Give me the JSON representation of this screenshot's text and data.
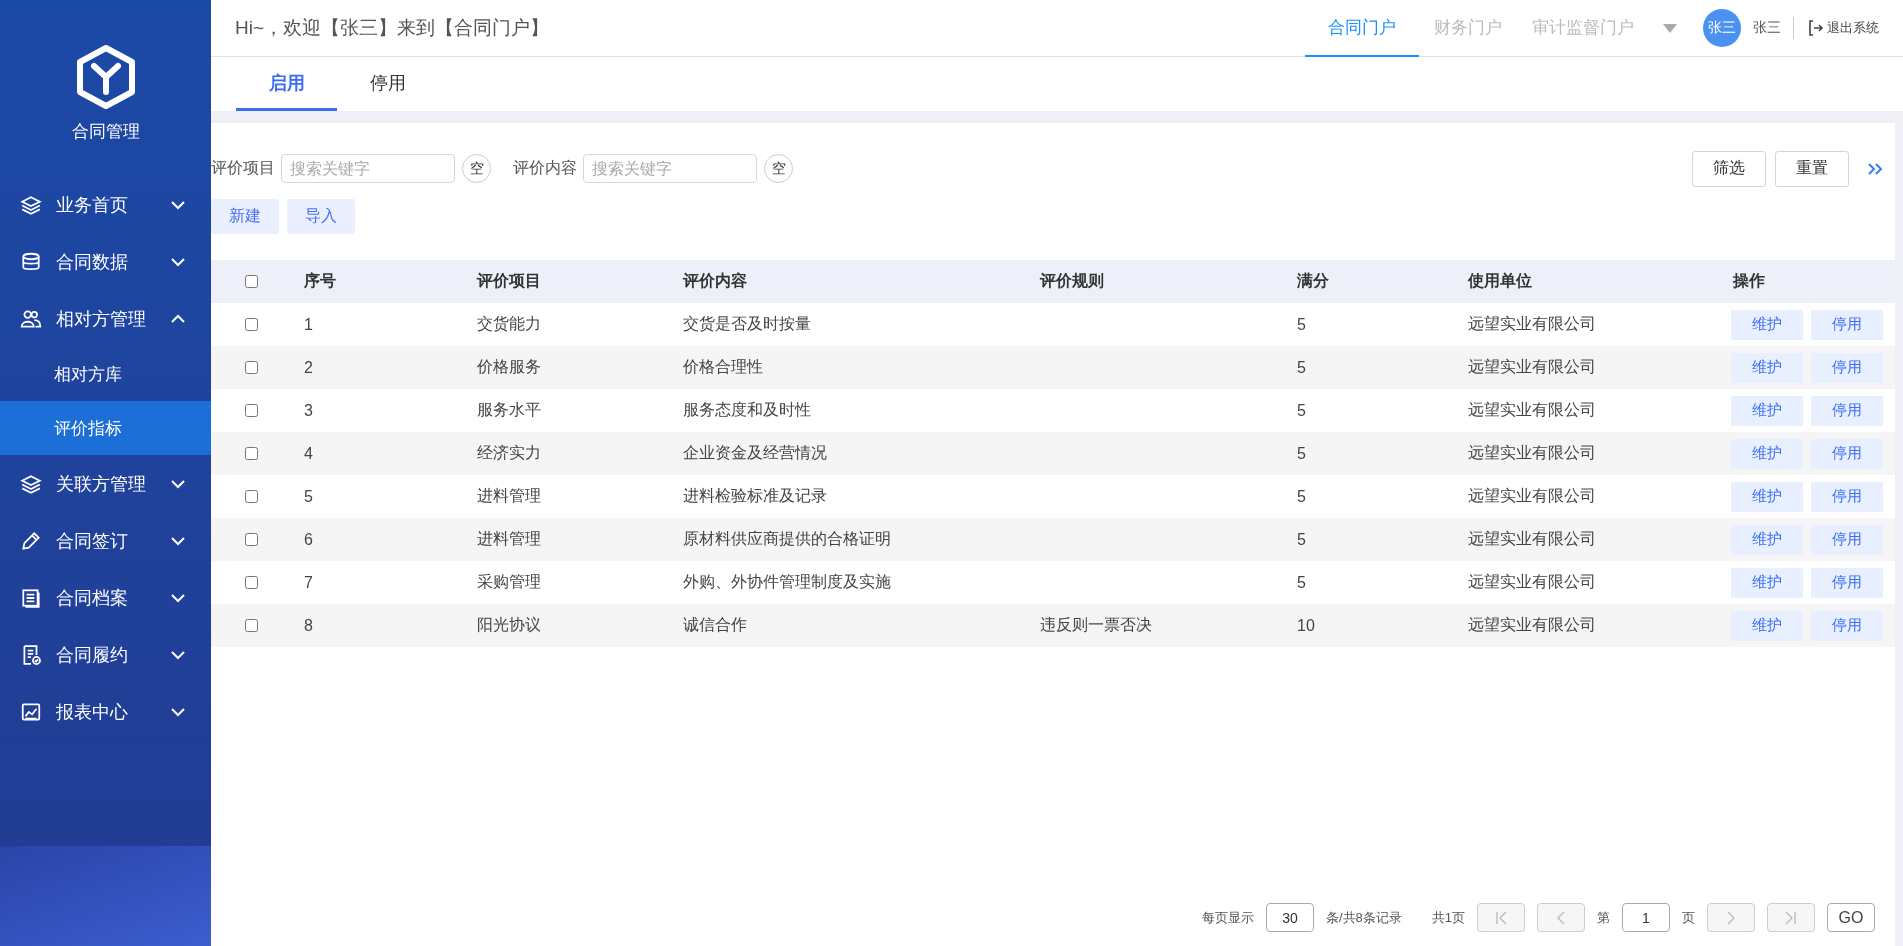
{
  "sidebar": {
    "title": "合同管理",
    "items": [
      {
        "label": "业务首页",
        "kind": "layers",
        "expanded": false
      },
      {
        "label": "合同数据",
        "kind": "database",
        "expanded": false
      },
      {
        "label": "相对方管理",
        "kind": "users",
        "expanded": true,
        "children": [
          {
            "label": "相对方库",
            "selected": false
          },
          {
            "label": "评价指标",
            "selected": true
          }
        ]
      },
      {
        "label": "关联方管理",
        "kind": "layers",
        "expanded": false
      },
      {
        "label": "合同签订",
        "kind": "pencil",
        "expanded": false
      },
      {
        "label": "合同档案",
        "kind": "book",
        "expanded": false
      },
      {
        "label": "合同履约",
        "kind": "check-doc",
        "expanded": false
      },
      {
        "label": "报表中心",
        "kind": "chart",
        "expanded": false
      }
    ]
  },
  "header": {
    "greeting": "Hi~，欢迎【张三】来到【合同门户】",
    "portals": [
      {
        "label": "合同门户",
        "selected": true
      },
      {
        "label": "财务门户",
        "selected": false
      },
      {
        "label": "审计监督门户",
        "selected": false
      }
    ],
    "avatar": "张三",
    "user": "张三",
    "logout": "退出系统"
  },
  "tabs": [
    {
      "label": "启用",
      "selected": true
    },
    {
      "label": "停用",
      "selected": false
    }
  ],
  "filters": [
    {
      "label": "评价项目",
      "placeholder": "搜索关键字",
      "clear": "空"
    },
    {
      "label": "评价内容",
      "placeholder": "搜索关键字",
      "clear": "空"
    }
  ],
  "filter_buttons": [
    "筛选",
    "重置"
  ],
  "actions": [
    "新建",
    "导入"
  ],
  "table": {
    "all_checked": false,
    "columns": [
      "序号",
      "评价项目",
      "评价内容",
      "评价规则",
      "满分",
      "使用单位",
      "操作"
    ],
    "rows": [
      {
        "checked": false,
        "cells": [
          "1",
          "交货能力",
          "交货是否及时按量",
          "",
          "5",
          "远望实业有限公司"
        ],
        "actions": [
          "维护",
          "停用"
        ]
      },
      {
        "checked": false,
        "cells": [
          "2",
          "价格服务",
          "价格合理性",
          "",
          "5",
          "远望实业有限公司"
        ],
        "actions": [
          "维护",
          "停用"
        ]
      },
      {
        "checked": false,
        "cells": [
          "3",
          "服务水平",
          "服务态度和及时性",
          "",
          "5",
          "远望实业有限公司"
        ],
        "actions": [
          "维护",
          "停用"
        ]
      },
      {
        "checked": false,
        "cells": [
          "4",
          "经济实力",
          "企业资金及经营情况",
          "",
          "5",
          "远望实业有限公司"
        ],
        "actions": [
          "维护",
          "停用"
        ]
      },
      {
        "checked": false,
        "cells": [
          "5",
          "进料管理",
          "进料检验标准及记录",
          "",
          "5",
          "远望实业有限公司"
        ],
        "actions": [
          "维护",
          "停用"
        ]
      },
      {
        "checked": false,
        "cells": [
          "6",
          "进料管理",
          "原材料供应商提供的合格证明",
          "",
          "5",
          "远望实业有限公司"
        ],
        "actions": [
          "维护",
          "停用"
        ]
      },
      {
        "checked": false,
        "cells": [
          "7",
          "采购管理",
          "外购、外协件管理制度及实施",
          "",
          "5",
          "远望实业有限公司"
        ],
        "actions": [
          "维护",
          "停用"
        ]
      },
      {
        "checked": false,
        "cells": [
          "8",
          "阳光协议",
          "诚信合作",
          "违反则一票否决",
          "10",
          "远望实业有限公司"
        ],
        "actions": [
          "维护",
          "停用"
        ]
      }
    ]
  },
  "pagination": {
    "per_page_label": "每页显示",
    "per_page": "30",
    "summary": "条/共8条记录",
    "pages": "共1页",
    "first_disabled": true,
    "prev_disabled": true,
    "page_prefix": "第",
    "page": "1",
    "page_suffix": "页",
    "next_disabled": true,
    "last_disabled": true,
    "go": "GO"
  }
}
